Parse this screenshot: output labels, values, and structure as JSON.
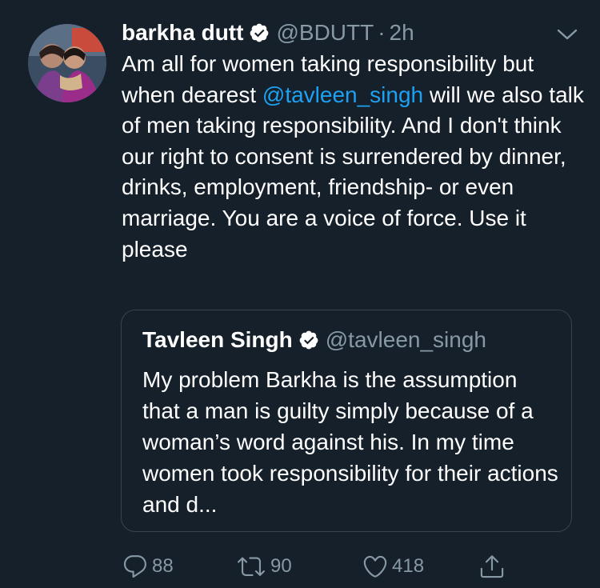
{
  "tweet": {
    "author": {
      "name": "barkha dutt",
      "handle": "@BDUTT",
      "separator": "·",
      "time": "2h"
    },
    "text_before_mention": "Am all for women taking responsibility but when dearest ",
    "mention": "@tavleen_singh",
    "text_after_mention": " will we also talk of men taking responsibility. And I don't think our  right to consent is surrendered by dinner, drinks, employment, friendship- or even marriage. You are a voice of force. Use it please"
  },
  "quoted_tweet": {
    "name": "Tavleen Singh",
    "handle": "@tavleen_singh",
    "text": "My problem Barkha is the assumption that a man is guilty simply because of a woman’s word against his. In my time women took responsibility for their actions and d..."
  },
  "actions": {
    "replies": "88",
    "retweets": "90",
    "likes": "418"
  },
  "colors": {
    "background": "#15202b",
    "text": "#ffffff",
    "secondary": "#8899a6",
    "link": "#1da1f2",
    "border": "#38444d"
  },
  "icons": {
    "reply": "reply-icon",
    "retweet": "retweet-icon",
    "like": "heart-icon",
    "share": "share-icon",
    "verified": "verified-badge-icon",
    "menu": "chevron-down-icon"
  }
}
